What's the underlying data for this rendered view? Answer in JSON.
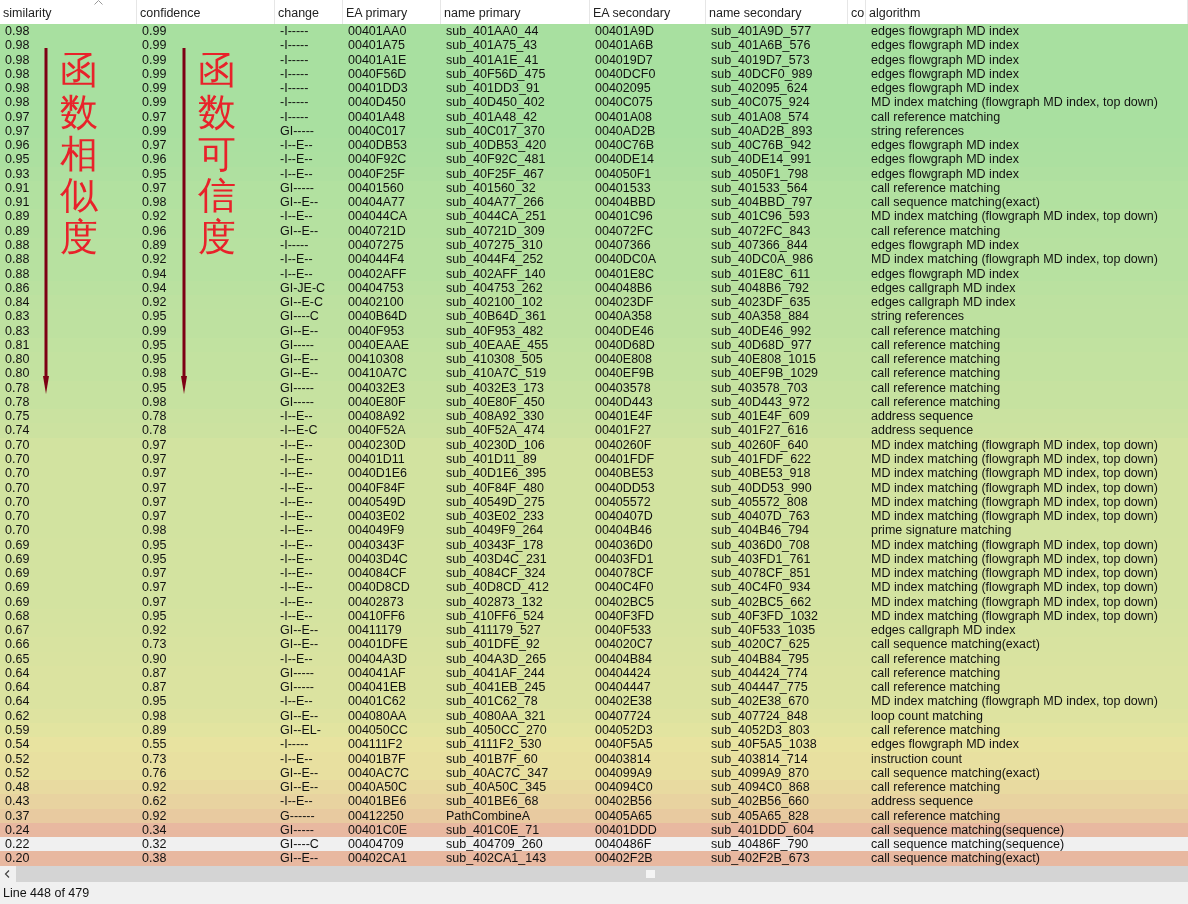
{
  "table": {
    "columns": [
      {
        "label": "similarity",
        "sorted": true
      },
      {
        "label": "confidence",
        "sorted": false
      },
      {
        "label": "change",
        "sorted": false
      },
      {
        "label": "EA primary",
        "sorted": false
      },
      {
        "label": "name primary",
        "sorted": false
      },
      {
        "label": "EA secondary",
        "sorted": false
      },
      {
        "label": "name secondary",
        "sorted": false
      },
      {
        "label": "co",
        "sorted": false
      },
      {
        "label": "algorithm",
        "sorted": false
      }
    ],
    "rows": [
      {
        "similarity": "0.98",
        "confidence": "0.99",
        "change": "-I-----",
        "ea_primary": "00401AA0",
        "name_primary": "sub_401AA0_44",
        "ea_secondary": "00401A9D",
        "name_secondary": "sub_401A9D_577",
        "algorithm": "edges flowgraph MD index",
        "selected": false
      },
      {
        "similarity": "0.98",
        "confidence": "0.99",
        "change": "-I-----",
        "ea_primary": "00401A75",
        "name_primary": "sub_401A75_43",
        "ea_secondary": "00401A6B",
        "name_secondary": "sub_401A6B_576",
        "algorithm": "edges flowgraph MD index",
        "selected": false
      },
      {
        "similarity": "0.98",
        "confidence": "0.99",
        "change": "-I-----",
        "ea_primary": "00401A1E",
        "name_primary": "sub_401A1E_41",
        "ea_secondary": "004019D7",
        "name_secondary": "sub_4019D7_573",
        "algorithm": "edges flowgraph MD index",
        "selected": false
      },
      {
        "similarity": "0.98",
        "confidence": "0.99",
        "change": "-I-----",
        "ea_primary": "0040F56D",
        "name_primary": "sub_40F56D_475",
        "ea_secondary": "0040DCF0",
        "name_secondary": "sub_40DCF0_989",
        "algorithm": "edges flowgraph MD index",
        "selected": false
      },
      {
        "similarity": "0.98",
        "confidence": "0.99",
        "change": "-I-----",
        "ea_primary": "00401DD3",
        "name_primary": "sub_401DD3_91",
        "ea_secondary": "00402095",
        "name_secondary": "sub_402095_624",
        "algorithm": "edges flowgraph MD index",
        "selected": false
      },
      {
        "similarity": "0.98",
        "confidence": "0.99",
        "change": "-I-----",
        "ea_primary": "0040D450",
        "name_primary": "sub_40D450_402",
        "ea_secondary": "0040C075",
        "name_secondary": "sub_40C075_924",
        "algorithm": "MD index matching (flowgraph MD index, top down)",
        "selected": false
      },
      {
        "similarity": "0.97",
        "confidence": "0.97",
        "change": "-I-----",
        "ea_primary": "00401A48",
        "name_primary": "sub_401A48_42",
        "ea_secondary": "00401A08",
        "name_secondary": "sub_401A08_574",
        "algorithm": "call reference matching",
        "selected": false
      },
      {
        "similarity": "0.97",
        "confidence": "0.99",
        "change": "GI-----",
        "ea_primary": "0040C017",
        "name_primary": "sub_40C017_370",
        "ea_secondary": "0040AD2B",
        "name_secondary": "sub_40AD2B_893",
        "algorithm": "string references",
        "selected": false
      },
      {
        "similarity": "0.96",
        "confidence": "0.97",
        "change": "-I--E--",
        "ea_primary": "0040DB53",
        "name_primary": "sub_40DB53_420",
        "ea_secondary": "0040C76B",
        "name_secondary": "sub_40C76B_942",
        "algorithm": "edges flowgraph MD index",
        "selected": false
      },
      {
        "similarity": "0.95",
        "confidence": "0.96",
        "change": "-I--E--",
        "ea_primary": "0040F92C",
        "name_primary": "sub_40F92C_481",
        "ea_secondary": "0040DE14",
        "name_secondary": "sub_40DE14_991",
        "algorithm": "edges flowgraph MD index",
        "selected": false
      },
      {
        "similarity": "0.93",
        "confidence": "0.95",
        "change": "-I--E--",
        "ea_primary": "0040F25F",
        "name_primary": "sub_40F25F_467",
        "ea_secondary": "004050F1",
        "name_secondary": "sub_4050F1_798",
        "algorithm": "edges flowgraph MD index",
        "selected": false
      },
      {
        "similarity": "0.91",
        "confidence": "0.97",
        "change": "GI-----",
        "ea_primary": "00401560",
        "name_primary": "sub_401560_32",
        "ea_secondary": "00401533",
        "name_secondary": "sub_401533_564",
        "algorithm": "call reference matching",
        "selected": false
      },
      {
        "similarity": "0.91",
        "confidence": "0.98",
        "change": "GI--E--",
        "ea_primary": "00404A77",
        "name_primary": "sub_404A77_266",
        "ea_secondary": "00404BBD",
        "name_secondary": "sub_404BBD_797",
        "algorithm": "call sequence matching(exact)",
        "selected": false
      },
      {
        "similarity": "0.89",
        "confidence": "0.92",
        "change": "-I--E--",
        "ea_primary": "004044CA",
        "name_primary": "sub_4044CA_251",
        "ea_secondary": "00401C96",
        "name_secondary": "sub_401C96_593",
        "algorithm": "MD index matching (flowgraph MD index, top down)",
        "selected": false
      },
      {
        "similarity": "0.89",
        "confidence": "0.96",
        "change": "GI--E--",
        "ea_primary": "0040721D",
        "name_primary": "sub_40721D_309",
        "ea_secondary": "004072FC",
        "name_secondary": "sub_4072FC_843",
        "algorithm": "call reference matching",
        "selected": false
      },
      {
        "similarity": "0.88",
        "confidence": "0.89",
        "change": "-I-----",
        "ea_primary": "00407275",
        "name_primary": "sub_407275_310",
        "ea_secondary": "00407366",
        "name_secondary": "sub_407366_844",
        "algorithm": "edges flowgraph MD index",
        "selected": false
      },
      {
        "similarity": "0.88",
        "confidence": "0.92",
        "change": "-I--E--",
        "ea_primary": "004044F4",
        "name_primary": "sub_4044F4_252",
        "ea_secondary": "0040DC0A",
        "name_secondary": "sub_40DC0A_986",
        "algorithm": "MD index matching (flowgraph MD index, top down)",
        "selected": false
      },
      {
        "similarity": "0.88",
        "confidence": "0.94",
        "change": "-I--E--",
        "ea_primary": "00402AFF",
        "name_primary": "sub_402AFF_140",
        "ea_secondary": "00401E8C",
        "name_secondary": "sub_401E8C_611",
        "algorithm": "edges flowgraph MD index",
        "selected": false
      },
      {
        "similarity": "0.86",
        "confidence": "0.94",
        "change": "GI-JE-C",
        "ea_primary": "00404753",
        "name_primary": "sub_404753_262",
        "ea_secondary": "004048B6",
        "name_secondary": "sub_4048B6_792",
        "algorithm": "edges callgraph MD index",
        "selected": false
      },
      {
        "similarity": "0.84",
        "confidence": "0.92",
        "change": "GI--E-C",
        "ea_primary": "00402100",
        "name_primary": "sub_402100_102",
        "ea_secondary": "004023DF",
        "name_secondary": "sub_4023DF_635",
        "algorithm": "edges callgraph MD index",
        "selected": false
      },
      {
        "similarity": "0.83",
        "confidence": "0.95",
        "change": "GI----C",
        "ea_primary": "0040B64D",
        "name_primary": "sub_40B64D_361",
        "ea_secondary": "0040A358",
        "name_secondary": "sub_40A358_884",
        "algorithm": "string references",
        "selected": false
      },
      {
        "similarity": "0.83",
        "confidence": "0.99",
        "change": "GI--E--",
        "ea_primary": "0040F953",
        "name_primary": "sub_40F953_482",
        "ea_secondary": "0040DE46",
        "name_secondary": "sub_40DE46_992",
        "algorithm": "call reference matching",
        "selected": false
      },
      {
        "similarity": "0.81",
        "confidence": "0.95",
        "change": "GI-----",
        "ea_primary": "0040EAAE",
        "name_primary": "sub_40EAAE_455",
        "ea_secondary": "0040D68D",
        "name_secondary": "sub_40D68D_977",
        "algorithm": "call reference matching",
        "selected": false
      },
      {
        "similarity": "0.80",
        "confidence": "0.95",
        "change": "GI--E--",
        "ea_primary": "00410308",
        "name_primary": "sub_410308_505",
        "ea_secondary": "0040E808",
        "name_secondary": "sub_40E808_1015",
        "algorithm": "call reference matching",
        "selected": false
      },
      {
        "similarity": "0.80",
        "confidence": "0.98",
        "change": "GI--E--",
        "ea_primary": "00410A7C",
        "name_primary": "sub_410A7C_519",
        "ea_secondary": "0040EF9B",
        "name_secondary": "sub_40EF9B_1029",
        "algorithm": "call reference matching",
        "selected": false
      },
      {
        "similarity": "0.78",
        "confidence": "0.95",
        "change": "GI-----",
        "ea_primary": "004032E3",
        "name_primary": "sub_4032E3_173",
        "ea_secondary": "00403578",
        "name_secondary": "sub_403578_703",
        "algorithm": "call reference matching",
        "selected": false
      },
      {
        "similarity": "0.78",
        "confidence": "0.98",
        "change": "GI-----",
        "ea_primary": "0040E80F",
        "name_primary": "sub_40E80F_450",
        "ea_secondary": "0040D443",
        "name_secondary": "sub_40D443_972",
        "algorithm": "call reference matching",
        "selected": false
      },
      {
        "similarity": "0.75",
        "confidence": "0.78",
        "change": "-I--E--",
        "ea_primary": "00408A92",
        "name_primary": "sub_408A92_330",
        "ea_secondary": "00401E4F",
        "name_secondary": "sub_401E4F_609",
        "algorithm": "address sequence",
        "selected": false
      },
      {
        "similarity": "0.74",
        "confidence": "0.78",
        "change": "-I--E-C",
        "ea_primary": "0040F52A",
        "name_primary": "sub_40F52A_474",
        "ea_secondary": "00401F27",
        "name_secondary": "sub_401F27_616",
        "algorithm": "address sequence",
        "selected": false
      },
      {
        "similarity": "0.70",
        "confidence": "0.97",
        "change": "-I--E--",
        "ea_primary": "0040230D",
        "name_primary": "sub_40230D_106",
        "ea_secondary": "0040260F",
        "name_secondary": "sub_40260F_640",
        "algorithm": "MD index matching (flowgraph MD index, top down)",
        "selected": false
      },
      {
        "similarity": "0.70",
        "confidence": "0.97",
        "change": "-I--E--",
        "ea_primary": "00401D11",
        "name_primary": "sub_401D11_89",
        "ea_secondary": "00401FDF",
        "name_secondary": "sub_401FDF_622",
        "algorithm": "MD index matching (flowgraph MD index, top down)",
        "selected": false
      },
      {
        "similarity": "0.70",
        "confidence": "0.97",
        "change": "-I--E--",
        "ea_primary": "0040D1E6",
        "name_primary": "sub_40D1E6_395",
        "ea_secondary": "0040BE53",
        "name_secondary": "sub_40BE53_918",
        "algorithm": "MD index matching (flowgraph MD index, top down)",
        "selected": false
      },
      {
        "similarity": "0.70",
        "confidence": "0.97",
        "change": "-I--E--",
        "ea_primary": "0040F84F",
        "name_primary": "sub_40F84F_480",
        "ea_secondary": "0040DD53",
        "name_secondary": "sub_40DD53_990",
        "algorithm": "MD index matching (flowgraph MD index, top down)",
        "selected": false
      },
      {
        "similarity": "0.70",
        "confidence": "0.97",
        "change": "-I--E--",
        "ea_primary": "0040549D",
        "name_primary": "sub_40549D_275",
        "ea_secondary": "00405572",
        "name_secondary": "sub_405572_808",
        "algorithm": "MD index matching (flowgraph MD index, top down)",
        "selected": false
      },
      {
        "similarity": "0.70",
        "confidence": "0.97",
        "change": "-I--E--",
        "ea_primary": "00403E02",
        "name_primary": "sub_403E02_233",
        "ea_secondary": "0040407D",
        "name_secondary": "sub_40407D_763",
        "algorithm": "MD index matching (flowgraph MD index, top down)",
        "selected": false
      },
      {
        "similarity": "0.70",
        "confidence": "0.98",
        "change": "-I--E--",
        "ea_primary": "004049F9",
        "name_primary": "sub_4049F9_264",
        "ea_secondary": "00404B46",
        "name_secondary": "sub_404B46_794",
        "algorithm": "prime signature matching",
        "selected": false
      },
      {
        "similarity": "0.69",
        "confidence": "0.95",
        "change": "-I--E--",
        "ea_primary": "0040343F",
        "name_primary": "sub_40343F_178",
        "ea_secondary": "004036D0",
        "name_secondary": "sub_4036D0_708",
        "algorithm": "MD index matching (flowgraph MD index, top down)",
        "selected": false
      },
      {
        "similarity": "0.69",
        "confidence": "0.95",
        "change": "-I--E--",
        "ea_primary": "00403D4C",
        "name_primary": "sub_403D4C_231",
        "ea_secondary": "00403FD1",
        "name_secondary": "sub_403FD1_761",
        "algorithm": "MD index matching (flowgraph MD index, top down)",
        "selected": false
      },
      {
        "similarity": "0.69",
        "confidence": "0.97",
        "change": "-I--E--",
        "ea_primary": "004084CF",
        "name_primary": "sub_4084CF_324",
        "ea_secondary": "004078CF",
        "name_secondary": "sub_4078CF_851",
        "algorithm": "MD index matching (flowgraph MD index, top down)",
        "selected": false
      },
      {
        "similarity": "0.69",
        "confidence": "0.97",
        "change": "-I--E--",
        "ea_primary": "0040D8CD",
        "name_primary": "sub_40D8CD_412",
        "ea_secondary": "0040C4F0",
        "name_secondary": "sub_40C4F0_934",
        "algorithm": "MD index matching (flowgraph MD index, top down)",
        "selected": false
      },
      {
        "similarity": "0.69",
        "confidence": "0.97",
        "change": "-I--E--",
        "ea_primary": "00402873",
        "name_primary": "sub_402873_132",
        "ea_secondary": "00402BC5",
        "name_secondary": "sub_402BC5_662",
        "algorithm": "MD index matching (flowgraph MD index, top down)",
        "selected": false
      },
      {
        "similarity": "0.68",
        "confidence": "0.95",
        "change": "-I--E--",
        "ea_primary": "00410FF6",
        "name_primary": "sub_410FF6_524",
        "ea_secondary": "0040F3FD",
        "name_secondary": "sub_40F3FD_1032",
        "algorithm": "MD index matching (flowgraph MD index, top down)",
        "selected": false
      },
      {
        "similarity": "0.67",
        "confidence": "0.92",
        "change": "GI--E--",
        "ea_primary": "00411179",
        "name_primary": "sub_411179_527",
        "ea_secondary": "0040F533",
        "name_secondary": "sub_40F533_1035",
        "algorithm": "edges callgraph MD index",
        "selected": false
      },
      {
        "similarity": "0.66",
        "confidence": "0.73",
        "change": "GI--E--",
        "ea_primary": "00401DFE",
        "name_primary": "sub_401DFE_92",
        "ea_secondary": "004020C7",
        "name_secondary": "sub_4020C7_625",
        "algorithm": "call sequence matching(exact)",
        "selected": false
      },
      {
        "similarity": "0.65",
        "confidence": "0.90",
        "change": "-I--E--",
        "ea_primary": "00404A3D",
        "name_primary": "sub_404A3D_265",
        "ea_secondary": "00404B84",
        "name_secondary": "sub_404B84_795",
        "algorithm": "call reference matching",
        "selected": false
      },
      {
        "similarity": "0.64",
        "confidence": "0.87",
        "change": "GI-----",
        "ea_primary": "004041AF",
        "name_primary": "sub_4041AF_244",
        "ea_secondary": "00404424",
        "name_secondary": "sub_404424_774",
        "algorithm": "call reference matching",
        "selected": false
      },
      {
        "similarity": "0.64",
        "confidence": "0.87",
        "change": "GI-----",
        "ea_primary": "004041EB",
        "name_primary": "sub_4041EB_245",
        "ea_secondary": "00404447",
        "name_secondary": "sub_404447_775",
        "algorithm": "call reference matching",
        "selected": false
      },
      {
        "similarity": "0.64",
        "confidence": "0.95",
        "change": "-I--E--",
        "ea_primary": "00401C62",
        "name_primary": "sub_401C62_78",
        "ea_secondary": "00402E38",
        "name_secondary": "sub_402E38_670",
        "algorithm": "MD index matching (flowgraph MD index, top down)",
        "selected": false
      },
      {
        "similarity": "0.62",
        "confidence": "0.98",
        "change": "GI--E--",
        "ea_primary": "004080AA",
        "name_primary": "sub_4080AA_321",
        "ea_secondary": "00407724",
        "name_secondary": "sub_407724_848",
        "algorithm": "loop count matching",
        "selected": false
      },
      {
        "similarity": "0.59",
        "confidence": "0.89",
        "change": "GI--EL-",
        "ea_primary": "004050CC",
        "name_primary": "sub_4050CC_270",
        "ea_secondary": "004052D3",
        "name_secondary": "sub_4052D3_803",
        "algorithm": "call reference matching",
        "selected": false
      },
      {
        "similarity": "0.54",
        "confidence": "0.55",
        "change": "-I-----",
        "ea_primary": "004111F2",
        "name_primary": "sub_4111F2_530",
        "ea_secondary": "0040F5A5",
        "name_secondary": "sub_40F5A5_1038",
        "algorithm": "edges flowgraph MD index",
        "selected": false
      },
      {
        "similarity": "0.52",
        "confidence": "0.73",
        "change": "-I--E--",
        "ea_primary": "00401B7F",
        "name_primary": "sub_401B7F_60",
        "ea_secondary": "00403814",
        "name_secondary": "sub_403814_714",
        "algorithm": "instruction count",
        "selected": false
      },
      {
        "similarity": "0.52",
        "confidence": "0.76",
        "change": "GI--E--",
        "ea_primary": "0040AC7C",
        "name_primary": "sub_40AC7C_347",
        "ea_secondary": "004099A9",
        "name_secondary": "sub_4099A9_870",
        "algorithm": "call sequence matching(exact)",
        "selected": false
      },
      {
        "similarity": "0.48",
        "confidence": "0.92",
        "change": "GI--E--",
        "ea_primary": "0040A50C",
        "name_primary": "sub_40A50C_345",
        "ea_secondary": "004094C0",
        "name_secondary": "sub_4094C0_868",
        "algorithm": "call reference matching",
        "selected": false
      },
      {
        "similarity": "0.43",
        "confidence": "0.62",
        "change": "-I--E--",
        "ea_primary": "00401BE6",
        "name_primary": "sub_401BE6_68",
        "ea_secondary": "00402B56",
        "name_secondary": "sub_402B56_660",
        "algorithm": "address sequence",
        "selected": false
      },
      {
        "similarity": "0.37",
        "confidence": "0.92",
        "change": "G------",
        "ea_primary": "00412250",
        "name_primary": "PathCombineA",
        "ea_secondary": "00405A65",
        "name_secondary": "sub_405A65_828",
        "algorithm": "call reference matching",
        "selected": false
      },
      {
        "similarity": "0.24",
        "confidence": "0.34",
        "change": "GI-----",
        "ea_primary": "00401C0E",
        "name_primary": "sub_401C0E_71",
        "ea_secondary": "00401DDD",
        "name_secondary": "sub_401DDD_604",
        "algorithm": "call sequence matching(sequence)",
        "selected": false
      },
      {
        "similarity": "0.22",
        "confidence": "0.32",
        "change": "GI----C",
        "ea_primary": "00404709",
        "name_primary": "sub_404709_260",
        "ea_secondary": "0040486F",
        "name_secondary": "sub_40486F_790",
        "algorithm": "call sequence matching(sequence)",
        "selected": true
      },
      {
        "similarity": "0.20",
        "confidence": "0.38",
        "change": "GI--E--",
        "ea_primary": "00402CA1",
        "name_primary": "sub_402CA1_143",
        "ea_secondary": "00402F2B",
        "name_secondary": "sub_402F2B_673",
        "algorithm": "call sequence matching(exact)",
        "selected": false
      }
    ]
  },
  "annotations": [
    {
      "text": "函数相似度"
    },
    {
      "text": "函数可信度"
    }
  ],
  "status_bar": {
    "text": "Line 448 of 479"
  }
}
